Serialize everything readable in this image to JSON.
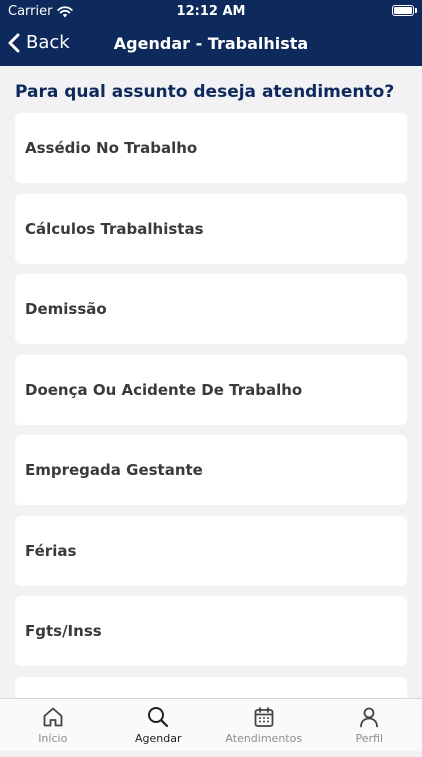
{
  "status_bar": {
    "carrier": "Carrier",
    "time": "12:12 AM"
  },
  "nav": {
    "back_label": "Back",
    "title": "Agendar - Trabalhista"
  },
  "prompt": "Para qual assunto deseja atendimento?",
  "subjects": [
    "Assédio No Trabalho",
    "Cálculos Trabalhistas",
    "Demissão",
    "Doença Ou Acidente De Trabalho",
    "Empregada Gestante",
    "Férias",
    "Fgts/Inss",
    ""
  ],
  "tabs": [
    {
      "label": "Início",
      "icon": "home-icon",
      "active": false
    },
    {
      "label": "Agendar",
      "icon": "search-icon",
      "active": true
    },
    {
      "label": "Atendimentos",
      "icon": "calendar-icon",
      "active": false
    },
    {
      "label": "Perfil",
      "icon": "person-icon",
      "active": false
    }
  ],
  "colors": {
    "header": "#0e2a5c",
    "prompt": "#0e2a5c",
    "background": "#f2f2f4",
    "tab_inactive": "#8e8e93"
  }
}
